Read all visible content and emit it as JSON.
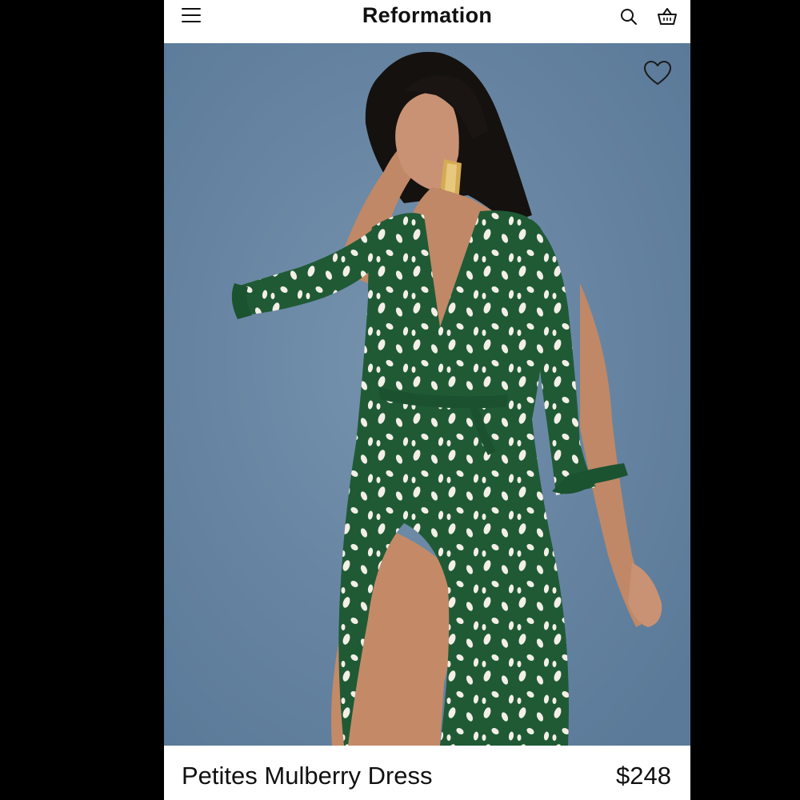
{
  "header": {
    "brand": "Reformation",
    "menu_icon": "hamburger-menu-icon",
    "search_icon": "search-icon",
    "bag_icon": "shopping-bag-icon"
  },
  "product": {
    "name": "Petites Mulberry Dress",
    "price": "$248",
    "wishlist_icon": "heart-outline-icon",
    "image_subject": "model in green wrap dress with white spots",
    "colors": {
      "dress": "#1f5a35",
      "spots": "#f3efe6",
      "background": "#6b8aa7"
    }
  }
}
